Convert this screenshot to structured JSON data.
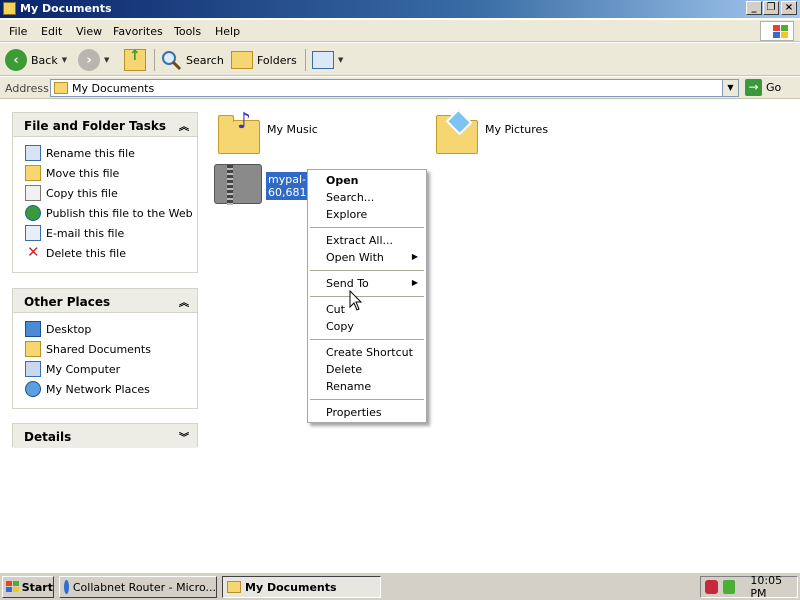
{
  "window": {
    "title": "My Documents"
  },
  "menu": [
    "File",
    "Edit",
    "View",
    "Favorites",
    "Tools",
    "Help"
  ],
  "toolbar": {
    "back": "Back",
    "search": "Search",
    "folders": "Folders"
  },
  "address": {
    "label": "Address",
    "value": "My Documents",
    "go": "Go"
  },
  "tasks": {
    "file_folder": {
      "title": "File and Folder Tasks",
      "items": [
        "Rename this file",
        "Move this file",
        "Copy this file",
        "Publish this file to the Web",
        "E-mail this file",
        "Delete this file"
      ]
    },
    "other_places": {
      "title": "Other Places",
      "items": [
        "Desktop",
        "Shared Documents",
        "My Computer",
        "My Network Places"
      ]
    },
    "details": {
      "title": "Details"
    }
  },
  "content": {
    "my_music": "My Music",
    "my_pictures": "My Pictures",
    "file_name": "mypal-7",
    "file_size": "60,681 I"
  },
  "context_menu": {
    "open": "Open",
    "search": "Search...",
    "explore": "Explore",
    "extract_all": "Extract All...",
    "open_with": "Open With",
    "send_to": "Send To",
    "cut": "Cut",
    "copy": "Copy",
    "create_shortcut": "Create Shortcut",
    "delete": "Delete",
    "rename": "Rename",
    "properties": "Properties"
  },
  "taskbar": {
    "start": "Start",
    "tasks": [
      "Collabnet Router - Micro...",
      "My Documents"
    ],
    "clock": "10:05 PM"
  }
}
